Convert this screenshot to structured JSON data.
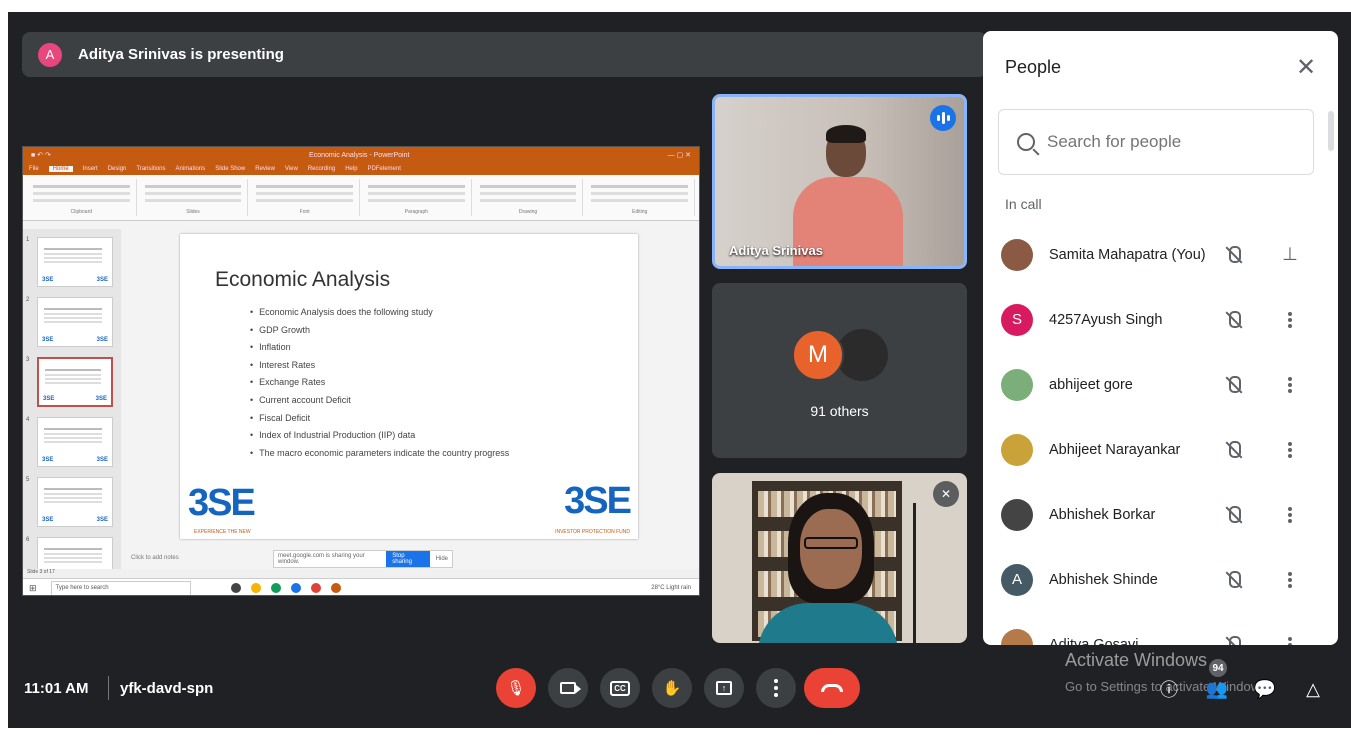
{
  "banner": {
    "avatar_letter": "A",
    "text": "Aditya Srinivas is presenting",
    "avatar_color": "#e8467c"
  },
  "slide": {
    "app_title": "Economic Analysis - PowerPoint",
    "tabs": [
      "File",
      "Home",
      "Insert",
      "Design",
      "Transitions",
      "Animations",
      "Slide Show",
      "Review",
      "View",
      "Recording",
      "Help",
      "PDFelement"
    ],
    "ribbon_groups": [
      "Clipboard",
      "Slides",
      "Font",
      "Paragraph",
      "Drawing",
      "Editing"
    ],
    "title": "Economic Analysis",
    "bullets": [
      "Economic Analysis does the following study",
      "GDP Growth",
      "Inflation",
      "Interest Rates",
      "Exchange Rates",
      "Current account Deficit",
      "Fiscal Deficit",
      "Index of Industrial Production (IIP) data",
      "The macro economic parameters indicate the country progress"
    ],
    "logo_text": "3SE",
    "logo_tag_left": "EXPERIENCE THE NEW",
    "logo_tag_right": "INVESTOR PROTECTION FUND",
    "notes_placeholder": "Click to add notes",
    "sharing_bar": {
      "text": "meet.google.com is sharing your window.",
      "stop": "Stop sharing",
      "hide": "Hide"
    },
    "status_text": "Slide 3 of 17",
    "taskbar_search": "Type here to search",
    "taskbar_weather": "28°C Light rain",
    "thumb_numbers": [
      "1",
      "2",
      "3",
      "4",
      "5",
      "6"
    ]
  },
  "tiles": {
    "presenter_name": "Aditya Srinivas",
    "others_avatar": "M",
    "others_label": "91 others"
  },
  "people": {
    "title": "People",
    "search_placeholder": "Search for people",
    "section": "In call",
    "list": [
      {
        "name": "Samita Mahapatra (You)",
        "avatar": "",
        "color": "#8a5a44",
        "action": "pin"
      },
      {
        "name": "4257Ayush Singh",
        "avatar": "S",
        "color": "#d81b60",
        "action": "more"
      },
      {
        "name": "abhijeet gore",
        "avatar": "",
        "color": "#7cae7a",
        "action": "more"
      },
      {
        "name": "Abhijeet Narayankar",
        "avatar": "",
        "color": "#c9a23a",
        "action": "more"
      },
      {
        "name": "Abhishek Borkar",
        "avatar": "",
        "color": "#444444",
        "action": "more"
      },
      {
        "name": "Abhishek Shinde",
        "avatar": "A",
        "color": "#455a64",
        "action": "more"
      },
      {
        "name": "Aditya Gosavi",
        "avatar": "",
        "color": "#b57a4a",
        "action": "more"
      }
    ]
  },
  "bottom": {
    "time": "11:01 AM",
    "meeting_code": "yfk-davd-spn",
    "activate_title": "Activate Windows",
    "activate_sub": "Go to Settings to activate Windows.",
    "participant_count": "94"
  },
  "colors": {
    "background": "#202124",
    "danger": "#ea4335",
    "accent": "#1a73e8"
  }
}
